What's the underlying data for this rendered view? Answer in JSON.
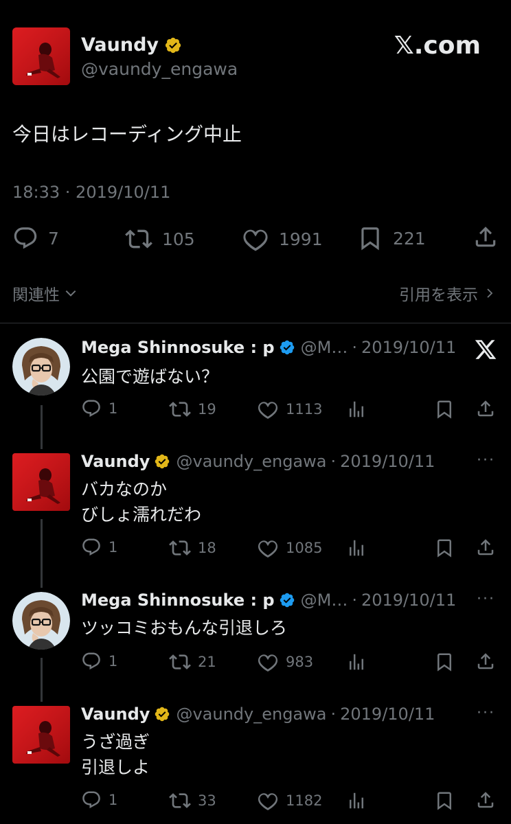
{
  "main_tweet": {
    "display_name": "Vaundy",
    "handle": "@vaundy_engawa",
    "brand": "𝕏.com",
    "text": "今日はレコーディング中止",
    "timestamp": "18:33 · 2019/10/11",
    "stats": {
      "replies": "7",
      "retweets": "105",
      "likes": "1991",
      "bookmarks": "221"
    },
    "related_label": "関連性",
    "quotes_label": "引用を表示"
  },
  "replies": [
    {
      "display_name": "Mega Shinnosuke : p",
      "handle": "@M…",
      "date": "2019/10/11",
      "text_lines": [
        "公園で遊ばない？"
      ],
      "stats": {
        "replies": "1",
        "retweets": "19",
        "likes": "1113"
      }
    },
    {
      "display_name": "Vaundy",
      "handle": "@vaundy_engawa",
      "date": "2019/10/11",
      "text_lines": [
        "バカなのか",
        "びしょ濡れだわ"
      ],
      "stats": {
        "replies": "1",
        "retweets": "18",
        "likes": "1085"
      }
    },
    {
      "display_name": "Mega Shinnosuke : p",
      "handle": "@M…",
      "date": "2019/10/11",
      "text_lines": [
        "ツッコミおもんな引退しろ"
      ],
      "stats": {
        "replies": "1",
        "retweets": "21",
        "likes": "983"
      }
    },
    {
      "display_name": "Vaundy",
      "handle": "@vaundy_engawa",
      "date": "2019/10/11",
      "text_lines": [
        "うざ過ぎ",
        "引退しよ"
      ],
      "stats": {
        "replies": "1",
        "retweets": "33",
        "likes": "1182"
      }
    }
  ],
  "colors": {
    "background": "#000000",
    "text": "#e7e9ea",
    "muted": "#71767b",
    "verified_gold": "#e2b719",
    "verified_blue": "#1d9bf0",
    "avatar_red": "#c8151b"
  },
  "icons": {
    "reply": "speech-bubble-icon",
    "retweet": "retweet-icon",
    "like": "heart-icon",
    "views": "bar-chart-icon",
    "bookmark": "bookmark-icon",
    "share": "share-icon",
    "more": "more-dots-icon",
    "x_logo": "x-logo-icon"
  }
}
